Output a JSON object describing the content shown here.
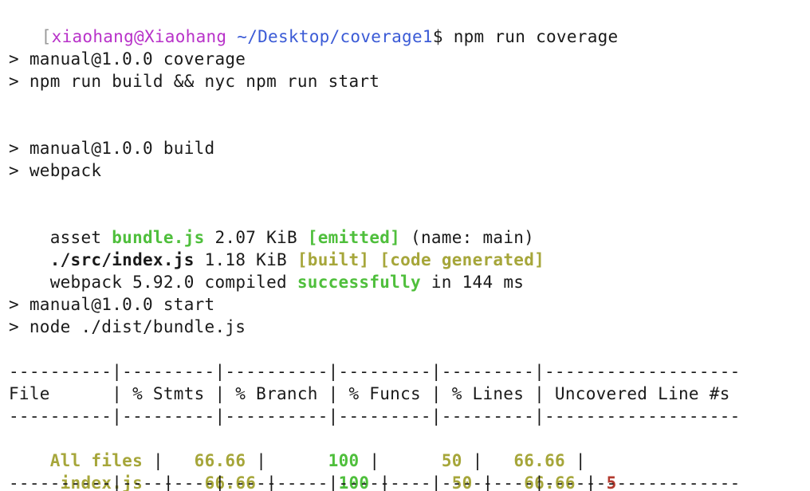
{
  "prompt": {
    "bracket": "[",
    "user_host": "xiaohang@Xiaohang",
    "path": "~/Desktop/coverage1",
    "symbol": "$",
    "command": " npm run coverage"
  },
  "script_coverage": {
    "line1": "> manual@1.0.0 coverage",
    "line2": "> npm run build && nyc npm run start"
  },
  "script_build": {
    "line1": "> manual@1.0.0 build",
    "line2": "> webpack"
  },
  "webpack_output": {
    "asset_label": "asset ",
    "asset_name": "bundle.js",
    "asset_size": " 2.07 KiB ",
    "asset_status": "[emitted]",
    "asset_meta": " (name: main)",
    "module_name": "./src/index.js",
    "module_size": " 1.18 KiB ",
    "module_status_built": "[built]",
    "module_space": " ",
    "module_status_generated": "[code generated]",
    "compile_prefix": "webpack 5.92.0 compiled ",
    "compile_status": "successfully",
    "compile_suffix": " in 144 ms"
  },
  "script_start": {
    "line1": "> manual@1.0.0 start",
    "line2": "> node ./dist/bundle.js"
  },
  "coverage_table": {
    "separator": "----------|---------|----------|---------|---------|-------------------",
    "headers": [
      "File",
      "% Stmts",
      "% Branch",
      "% Funcs",
      "% Lines",
      "Uncovered Line #s"
    ],
    "header_line": "File      | % Stmts | % Branch | % Funcs | % Lines | Uncovered Line #s",
    "rows": [
      {
        "file": "All files",
        "stmts": "66.66",
        "branch": "100",
        "funcs": "50",
        "lines": "66.66",
        "uncovered": ""
      },
      {
        "file": " index.js",
        "stmts": "66.66",
        "branch": "100",
        "funcs": "50",
        "lines": "66.66",
        "uncovered": "5"
      }
    ]
  },
  "colors": {
    "green": "#4fbf3c",
    "olive": "#a6a63a",
    "red": "#b23a2e",
    "user": "#b832c9",
    "path": "#3b5bd6"
  }
}
